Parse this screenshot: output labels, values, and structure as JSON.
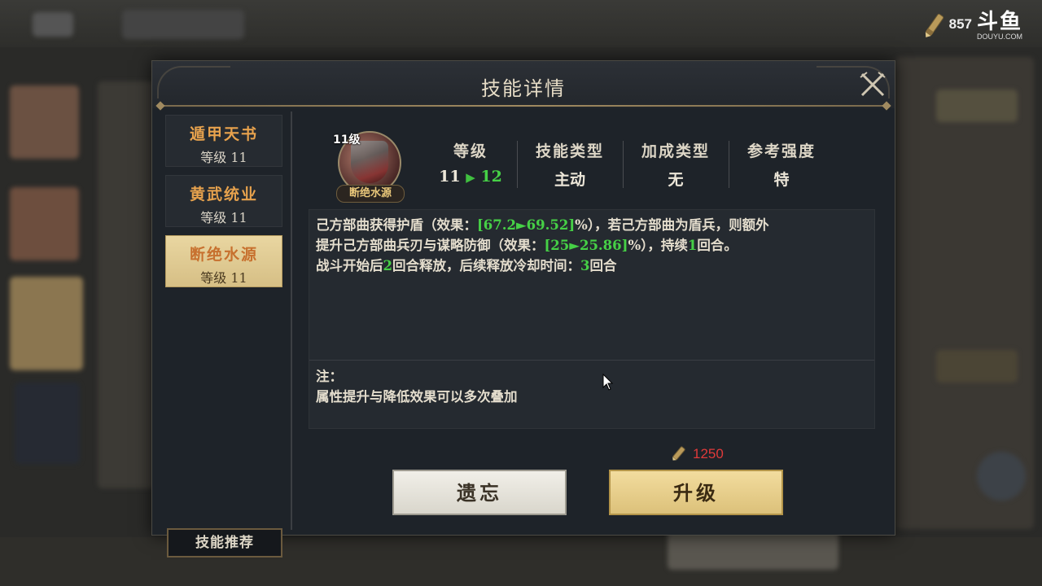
{
  "watermark": {
    "number": "857",
    "logo_cn": "斗鱼",
    "logo_en": "DOUYU.COM"
  },
  "dialog": {
    "title": "技能详情",
    "close_icon": "close-x-icon"
  },
  "sidebar": {
    "items": [
      {
        "name": "遁甲天书",
        "level": "等级 11",
        "active": false
      },
      {
        "name": "黄武统业",
        "level": "等级 11",
        "active": false
      },
      {
        "name": "断绝水源",
        "level": "等级 11",
        "active": true
      }
    ],
    "recommend_label": "技能推荐"
  },
  "skill": {
    "icon_level": "11级",
    "icon_name": "断绝水源",
    "stats": {
      "level_label": "等级",
      "level_from": "11",
      "level_arrow": "▶",
      "level_to": "12",
      "type_label": "技能类型",
      "type_value": "主动",
      "bonus_label": "加成类型",
      "bonus_value": "无",
      "strength_label": "参考强度",
      "strength_value": "特"
    },
    "description": {
      "l1_a": "己方部曲获得护盾（效果：",
      "l1_g": "[67.2►69.52]",
      "l1_b": "%），若己方部曲为盾兵，则额外",
      "l2_a": "提升己方部曲兵刃与谋略防御（效果：",
      "l2_g": "[25►25.86]",
      "l2_b": "%），持续",
      "l2_g2": "1",
      "l2_c": "回合。",
      "l3_a": "战斗开始后",
      "l3_g": "2",
      "l3_b": "回合释放，后续释放冷却时间：",
      "l3_g2": "3",
      "l3_c": "回合"
    },
    "note_title": "注：",
    "note_text": "属性提升与降低效果可以多次叠加"
  },
  "cost": {
    "icon": "scroll-icon",
    "amount": "1250"
  },
  "buttons": {
    "forget": "遗忘",
    "upgrade": "升级"
  },
  "colors": {
    "highlight_green": "#46d046",
    "cost_red": "#e03a3a",
    "tab_orange": "#e7a24d",
    "gold": "#dcc17a"
  }
}
